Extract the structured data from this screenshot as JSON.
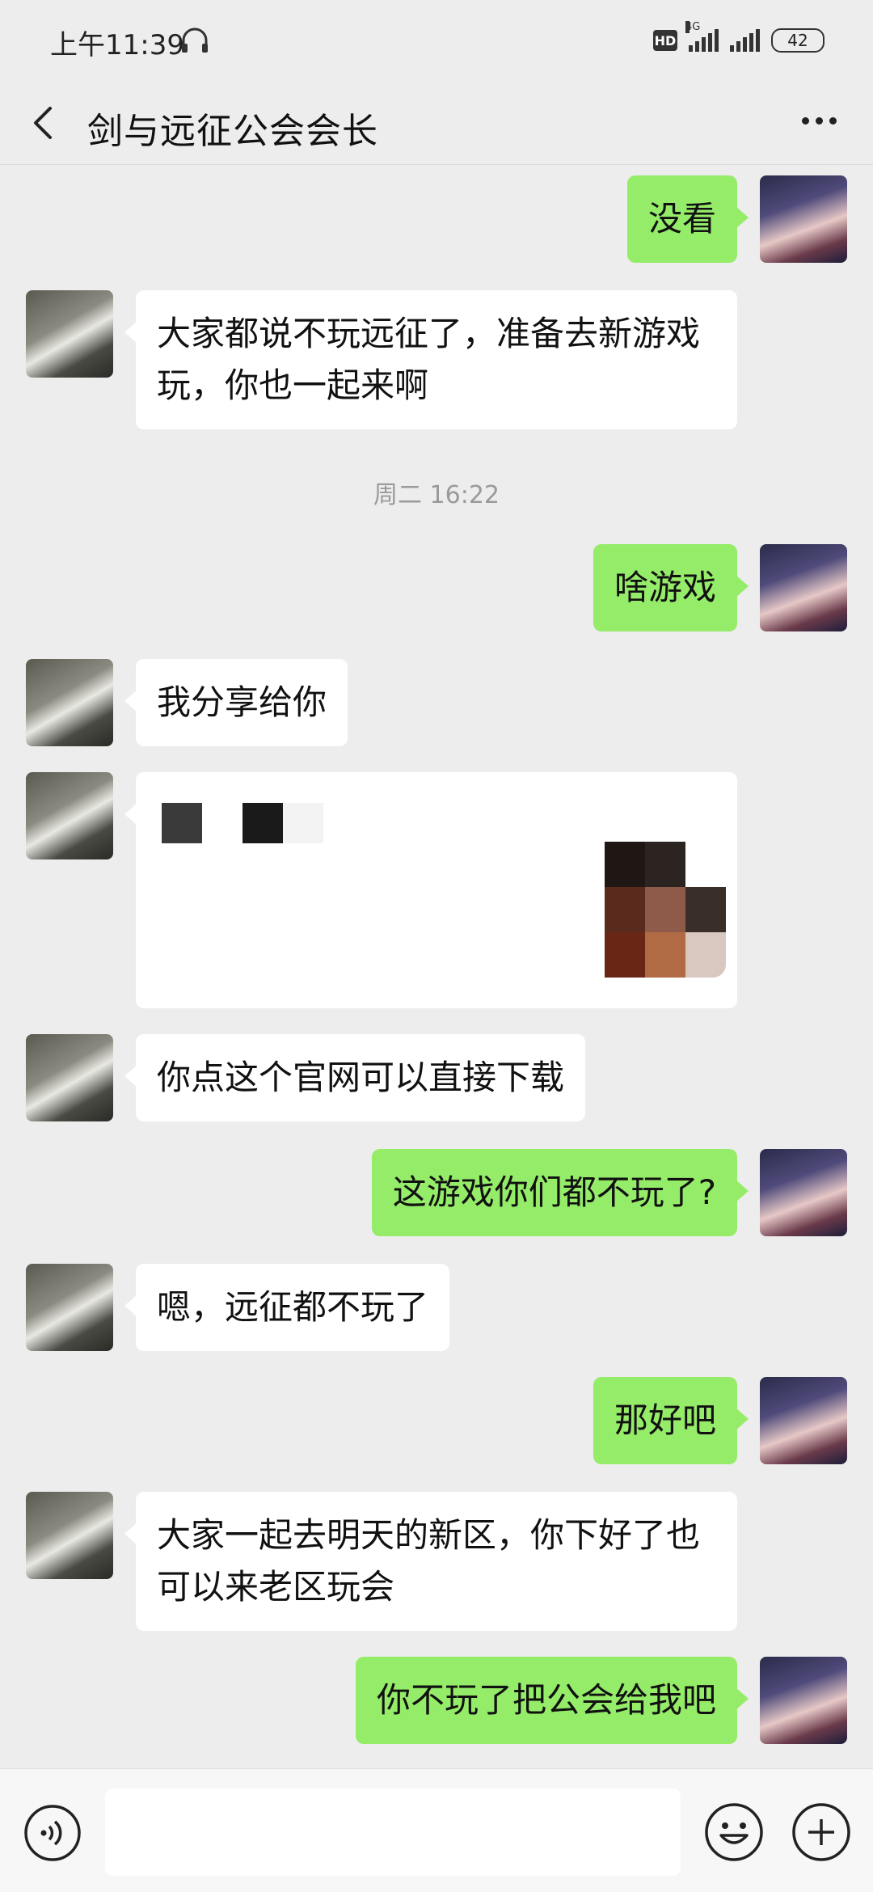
{
  "status_bar": {
    "time": "上午11:39",
    "hd": "HD",
    "network": "4G",
    "battery": "42"
  },
  "header": {
    "title": "剑与远征公会会长"
  },
  "messages": [
    {
      "from": "self",
      "text": "没看"
    },
    {
      "from": "peer",
      "text": "大家都说不玩远征了，准备去新游戏玩，你也一起来啊"
    },
    {
      "type": "timestamp",
      "text": "周二 16:22"
    },
    {
      "from": "self",
      "text": "啥游戏"
    },
    {
      "from": "peer",
      "text": "我分享给你"
    },
    {
      "from": "peer",
      "type": "share-card",
      "text": ""
    },
    {
      "from": "peer",
      "text": "你点这个官网可以直接下载"
    },
    {
      "from": "self",
      "text": "这游戏你们都不玩了?"
    },
    {
      "from": "peer",
      "text": "嗯，远征都不玩了"
    },
    {
      "from": "self",
      "text": "那好吧"
    },
    {
      "from": "peer",
      "text": "大家一起去明天的新区，你下好了也可以来老区玩会"
    },
    {
      "from": "self",
      "text": "你不玩了把公会给我吧"
    }
  ],
  "input": {
    "value": "",
    "placeholder": ""
  },
  "colors": {
    "self_bubble": "#95ec69",
    "peer_bubble": "#ffffff",
    "background": "#ededed"
  },
  "icons": {
    "back": "back-arrow-icon",
    "more": "more-dots-icon",
    "voice": "voice-icon",
    "emoji": "emoji-icon",
    "plus": "plus-icon",
    "headset": "headset-icon"
  }
}
